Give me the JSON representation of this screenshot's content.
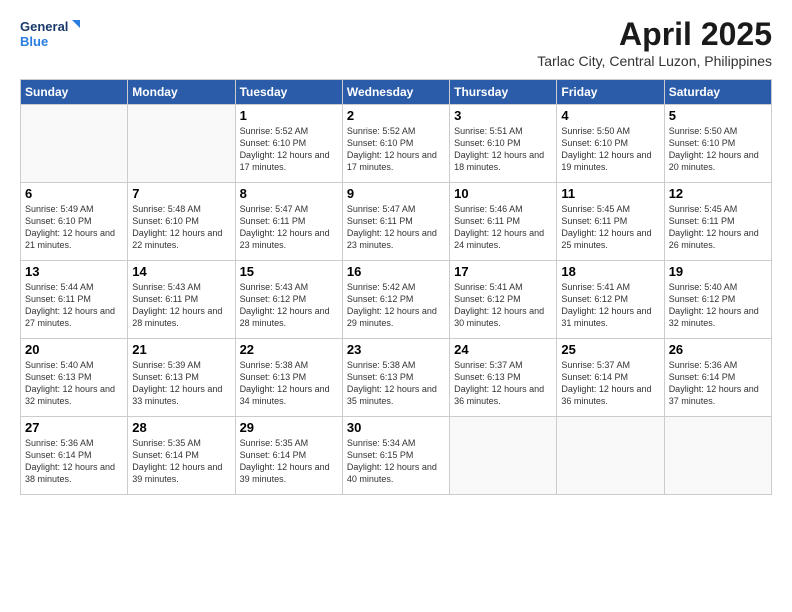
{
  "logo": {
    "line1": "General",
    "line2": "Blue"
  },
  "title": "April 2025",
  "subtitle": "Tarlac City, Central Luzon, Philippines",
  "days_of_week": [
    "Sunday",
    "Monday",
    "Tuesday",
    "Wednesday",
    "Thursday",
    "Friday",
    "Saturday"
  ],
  "weeks": [
    [
      {
        "day": "",
        "info": ""
      },
      {
        "day": "",
        "info": ""
      },
      {
        "day": "1",
        "info": "Sunrise: 5:52 AM\nSunset: 6:10 PM\nDaylight: 12 hours and 17 minutes."
      },
      {
        "day": "2",
        "info": "Sunrise: 5:52 AM\nSunset: 6:10 PM\nDaylight: 12 hours and 17 minutes."
      },
      {
        "day": "3",
        "info": "Sunrise: 5:51 AM\nSunset: 6:10 PM\nDaylight: 12 hours and 18 minutes."
      },
      {
        "day": "4",
        "info": "Sunrise: 5:50 AM\nSunset: 6:10 PM\nDaylight: 12 hours and 19 minutes."
      },
      {
        "day": "5",
        "info": "Sunrise: 5:50 AM\nSunset: 6:10 PM\nDaylight: 12 hours and 20 minutes."
      }
    ],
    [
      {
        "day": "6",
        "info": "Sunrise: 5:49 AM\nSunset: 6:10 PM\nDaylight: 12 hours and 21 minutes."
      },
      {
        "day": "7",
        "info": "Sunrise: 5:48 AM\nSunset: 6:10 PM\nDaylight: 12 hours and 22 minutes."
      },
      {
        "day": "8",
        "info": "Sunrise: 5:47 AM\nSunset: 6:11 PM\nDaylight: 12 hours and 23 minutes."
      },
      {
        "day": "9",
        "info": "Sunrise: 5:47 AM\nSunset: 6:11 PM\nDaylight: 12 hours and 23 minutes."
      },
      {
        "day": "10",
        "info": "Sunrise: 5:46 AM\nSunset: 6:11 PM\nDaylight: 12 hours and 24 minutes."
      },
      {
        "day": "11",
        "info": "Sunrise: 5:45 AM\nSunset: 6:11 PM\nDaylight: 12 hours and 25 minutes."
      },
      {
        "day": "12",
        "info": "Sunrise: 5:45 AM\nSunset: 6:11 PM\nDaylight: 12 hours and 26 minutes."
      }
    ],
    [
      {
        "day": "13",
        "info": "Sunrise: 5:44 AM\nSunset: 6:11 PM\nDaylight: 12 hours and 27 minutes."
      },
      {
        "day": "14",
        "info": "Sunrise: 5:43 AM\nSunset: 6:11 PM\nDaylight: 12 hours and 28 minutes."
      },
      {
        "day": "15",
        "info": "Sunrise: 5:43 AM\nSunset: 6:12 PM\nDaylight: 12 hours and 28 minutes."
      },
      {
        "day": "16",
        "info": "Sunrise: 5:42 AM\nSunset: 6:12 PM\nDaylight: 12 hours and 29 minutes."
      },
      {
        "day": "17",
        "info": "Sunrise: 5:41 AM\nSunset: 6:12 PM\nDaylight: 12 hours and 30 minutes."
      },
      {
        "day": "18",
        "info": "Sunrise: 5:41 AM\nSunset: 6:12 PM\nDaylight: 12 hours and 31 minutes."
      },
      {
        "day": "19",
        "info": "Sunrise: 5:40 AM\nSunset: 6:12 PM\nDaylight: 12 hours and 32 minutes."
      }
    ],
    [
      {
        "day": "20",
        "info": "Sunrise: 5:40 AM\nSunset: 6:13 PM\nDaylight: 12 hours and 32 minutes."
      },
      {
        "day": "21",
        "info": "Sunrise: 5:39 AM\nSunset: 6:13 PM\nDaylight: 12 hours and 33 minutes."
      },
      {
        "day": "22",
        "info": "Sunrise: 5:38 AM\nSunset: 6:13 PM\nDaylight: 12 hours and 34 minutes."
      },
      {
        "day": "23",
        "info": "Sunrise: 5:38 AM\nSunset: 6:13 PM\nDaylight: 12 hours and 35 minutes."
      },
      {
        "day": "24",
        "info": "Sunrise: 5:37 AM\nSunset: 6:13 PM\nDaylight: 12 hours and 36 minutes."
      },
      {
        "day": "25",
        "info": "Sunrise: 5:37 AM\nSunset: 6:14 PM\nDaylight: 12 hours and 36 minutes."
      },
      {
        "day": "26",
        "info": "Sunrise: 5:36 AM\nSunset: 6:14 PM\nDaylight: 12 hours and 37 minutes."
      }
    ],
    [
      {
        "day": "27",
        "info": "Sunrise: 5:36 AM\nSunset: 6:14 PM\nDaylight: 12 hours and 38 minutes."
      },
      {
        "day": "28",
        "info": "Sunrise: 5:35 AM\nSunset: 6:14 PM\nDaylight: 12 hours and 39 minutes."
      },
      {
        "day": "29",
        "info": "Sunrise: 5:35 AM\nSunset: 6:14 PM\nDaylight: 12 hours and 39 minutes."
      },
      {
        "day": "30",
        "info": "Sunrise: 5:34 AM\nSunset: 6:15 PM\nDaylight: 12 hours and 40 minutes."
      },
      {
        "day": "",
        "info": ""
      },
      {
        "day": "",
        "info": ""
      },
      {
        "day": "",
        "info": ""
      }
    ]
  ]
}
